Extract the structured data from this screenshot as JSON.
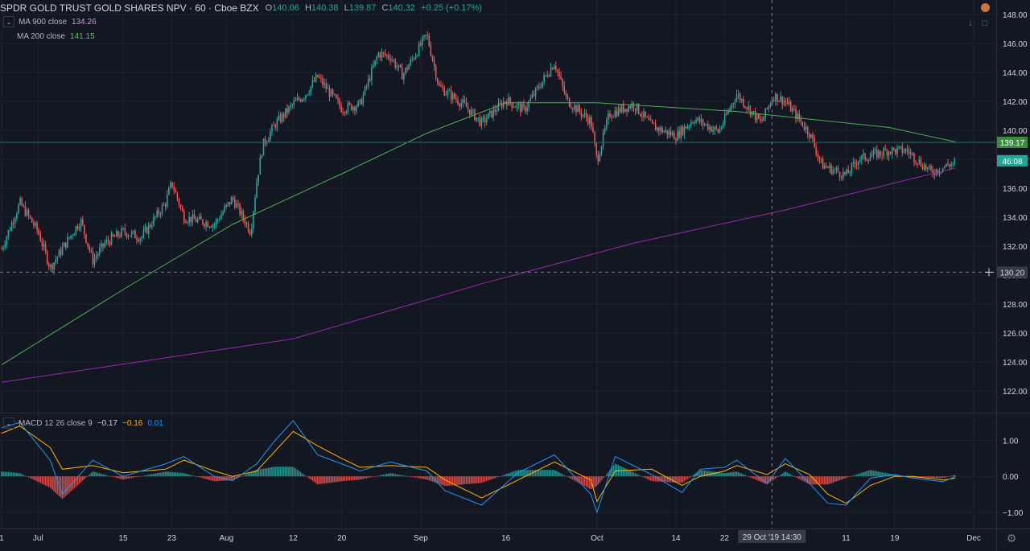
{
  "header": {
    "symbol": "SPDR GOLD TRUST GOLD SHARES NPV · 60 · Cboe BZX",
    "o_label": "O",
    "o_value": "140.06",
    "h_label": "H",
    "h_value": "140.38",
    "l_label": "L",
    "l_value": "139.87",
    "c_label": "C",
    "c_value": "140.32",
    "change": "+0.25 (+0.17%)"
  },
  "indicators": {
    "ma900_label": "MA 900 close",
    "ma900_value": "134.26",
    "ma200_label": "MA 200 close",
    "ma200_value": "141.15",
    "macd_label": "MACD 12 26 close 9",
    "macd_value": "−0.17",
    "signal_value": "−0.16",
    "hist_value": "0.01"
  },
  "colors": {
    "background": "#131722",
    "grid": "#1e222d",
    "up": "#26a69a",
    "down": "#ef5350",
    "ma900": "#9c27b0",
    "ma200": "#4caf50",
    "macd_line": "#2196f3",
    "signal_line": "#ffb300",
    "text": "#b2b5be",
    "axis_text": "#d1d4dc",
    "last_price_bg": "#26a69a",
    "ma200_tag_bg": "#388e3c"
  },
  "icons": {
    "collapse": "chevron-down-icon",
    "top_dot": "status-dot-icon",
    "scroll_down": "arrow-down-icon",
    "fullscreen": "fullscreen-icon",
    "settings": "gear-icon"
  },
  "price_tags": {
    "ma200": "139.17",
    "last": "46:08",
    "crosshair": "130.20"
  },
  "crosshair_time": "29 Oct '19   14:30",
  "chart_data": [
    {
      "type": "candlestick",
      "title": "SPDR GOLD TRUST GOLD SHARES NPV · 60 · Cboe BZX",
      "ylim": [
        120.5,
        149.0
      ],
      "y_ticks": [
        "148.00",
        "146.00",
        "144.00",
        "142.00",
        "140.00",
        "138.00",
        "136.00",
        "134.00",
        "132.00",
        "130.00",
        "128.00",
        "126.00",
        "124.00",
        "122.00"
      ],
      "x_ticks": [
        "1",
        "Jul",
        "15",
        "23",
        "Aug",
        "12",
        "20",
        "Sep",
        "16",
        "Oct",
        "14",
        "22",
        "11",
        "19",
        "Dec"
      ],
      "grid": true,
      "close_path": [
        [
          "Jun 25",
          131.8
        ],
        [
          "Jun 28",
          135.0
        ],
        [
          "Jul 1",
          133.0
        ],
        [
          "Jul 3",
          130.5
        ],
        [
          "Jul 8",
          133.8
        ],
        [
          "Jul 10",
          131.0
        ],
        [
          "Jul 12",
          132.2
        ],
        [
          "Jul 15",
          133.0
        ],
        [
          "Jul 18",
          132.6
        ],
        [
          "Jul 22",
          135.0
        ],
        [
          "Jul 23",
          136.4
        ],
        [
          "Jul 25",
          134.0
        ],
        [
          "Jul 30",
          133.5
        ],
        [
          "Aug 2",
          135.3
        ],
        [
          "Aug 5",
          133.0
        ],
        [
          "Aug 6",
          136.5
        ],
        [
          "Aug 7",
          139.0
        ],
        [
          "Aug 9",
          140.4
        ],
        [
          "Aug 12",
          141.8
        ],
        [
          "Aug 14",
          142.5
        ],
        [
          "Aug 16",
          143.7
        ],
        [
          "Aug 20",
          141.5
        ],
        [
          "Aug 23",
          141.8
        ],
        [
          "Aug 26",
          145.3
        ],
        [
          "Aug 28",
          145.1
        ],
        [
          "Aug 30",
          143.8
        ],
        [
          "Sep 3",
          146.6
        ],
        [
          "Sep 5",
          143.0
        ],
        [
          "Sep 9",
          141.8
        ],
        [
          "Sep 12",
          140.5
        ],
        [
          "Sep 16",
          142.1
        ],
        [
          "Sep 19",
          141.4
        ],
        [
          "Sep 24",
          144.7
        ],
        [
          "Sep 26",
          142.1
        ],
        [
          "Sep 30",
          140.6
        ],
        [
          "Oct 1",
          137.9
        ],
        [
          "Oct 3",
          141.1
        ],
        [
          "Oct 7",
          141.8
        ],
        [
          "Oct 10",
          140.3
        ],
        [
          "Oct 14",
          139.6
        ],
        [
          "Oct 17",
          140.8
        ],
        [
          "Oct 21",
          139.9
        ],
        [
          "Oct 24",
          142.5
        ],
        [
          "Oct 28",
          140.5
        ],
        [
          "Oct 30",
          142.4
        ],
        [
          "Nov 1",
          142.0
        ],
        [
          "Nov 5",
          139.8
        ],
        [
          "Nov 7",
          137.6
        ],
        [
          "Nov 11",
          136.9
        ],
        [
          "Nov 13",
          138.0
        ],
        [
          "Nov 18",
          138.6
        ],
        [
          "Nov 21",
          138.6
        ],
        [
          "Nov 25",
          137.1
        ],
        [
          "Nov 29",
          137.8
        ]
      ],
      "ma900": {
        "label": "MA 900 close",
        "last": 134.26,
        "points": [
          [
            "Jun 25",
            122.6
          ],
          [
            "Aug 12",
            125.6
          ],
          [
            "Sep 12",
            129.4
          ],
          [
            "Oct 7",
            132.2
          ],
          [
            "Nov 1",
            134.5
          ],
          [
            "Nov 29",
            137.4
          ]
        ]
      },
      "ma200": {
        "label": "MA 200 close",
        "last": 141.15,
        "points": [
          [
            "Jun 25",
            123.8
          ],
          [
            "Jul 15",
            129.0
          ],
          [
            "Aug 2",
            133.5
          ],
          [
            "Aug 20",
            137.0
          ],
          [
            "Sep 3",
            139.8
          ],
          [
            "Sep 16",
            141.9
          ],
          [
            "Oct 1",
            141.9
          ],
          [
            "Oct 24",
            141.3
          ],
          [
            "Nov 18",
            140.2
          ],
          [
            "Nov 29",
            139.2
          ]
        ]
      },
      "horizontal_lines": [
        139.17,
        130.2
      ]
    },
    {
      "type": "macd",
      "title": "MACD 12 26 close 9",
      "ylim": [
        -1.45,
        1.75
      ],
      "y_ticks": [
        "1.00",
        "0.00",
        "−1.00"
      ],
      "macd_path": [
        [
          "Jun 25",
          1.35
        ],
        [
          "Jun 28",
          1.5
        ],
        [
          "Jul 3",
          0.45
        ],
        [
          "Jul 5",
          -0.5
        ],
        [
          "Jul 10",
          0.45
        ],
        [
          "Jul 15",
          0.0
        ],
        [
          "Jul 22",
          0.35
        ],
        [
          "Jul 25",
          0.55
        ],
        [
          "Jul 30",
          0.0
        ],
        [
          "Aug 2",
          -0.12
        ],
        [
          "Aug 6",
          0.35
        ],
        [
          "Aug 9",
          1.0
        ],
        [
          "Aug 12",
          1.55
        ],
        [
          "Aug 16",
          0.6
        ],
        [
          "Aug 20",
          0.35
        ],
        [
          "Aug 23",
          0.15
        ],
        [
          "Aug 28",
          0.4
        ],
        [
          "Sep 3",
          0.15
        ],
        [
          "Sep 6",
          -0.4
        ],
        [
          "Sep 12",
          -0.8
        ],
        [
          "Sep 18",
          0.1
        ],
        [
          "Sep 24",
          0.6
        ],
        [
          "Sep 30",
          -0.5
        ],
        [
          "Oct 1",
          -1.0
        ],
        [
          "Oct 4",
          0.55
        ],
        [
          "Oct 10",
          0.05
        ],
        [
          "Oct 15",
          -0.45
        ],
        [
          "Oct 18",
          0.2
        ],
        [
          "Oct 22",
          0.25
        ],
        [
          "Oct 24",
          0.45
        ],
        [
          "Oct 29",
          -0.2
        ],
        [
          "Nov 1",
          0.5
        ],
        [
          "Nov 5",
          -0.2
        ],
        [
          "Nov 8",
          -0.75
        ],
        [
          "Nov 11",
          -0.8
        ],
        [
          "Nov 15",
          -0.05
        ],
        [
          "Nov 19",
          0.05
        ],
        [
          "Nov 22",
          -0.05
        ],
        [
          "Nov 27",
          -0.15
        ],
        [
          "Nov 29",
          0.0
        ]
      ],
      "signal_path": [
        [
          "Jun 25",
          1.2
        ],
        [
          "Jun 28",
          1.4
        ],
        [
          "Jul 3",
          0.8
        ],
        [
          "Jul 5",
          0.2
        ],
        [
          "Jul 10",
          0.3
        ],
        [
          "Jul 15",
          0.1
        ],
        [
          "Jul 22",
          0.2
        ],
        [
          "Jul 25",
          0.45
        ],
        [
          "Jul 30",
          0.15
        ],
        [
          "Aug 2",
          0.0
        ],
        [
          "Aug 6",
          0.15
        ],
        [
          "Aug 9",
          0.7
        ],
        [
          "Aug 12",
          1.25
        ],
        [
          "Aug 16",
          0.85
        ],
        [
          "Aug 20",
          0.5
        ],
        [
          "Aug 23",
          0.25
        ],
        [
          "Aug 28",
          0.3
        ],
        [
          "Sep 3",
          0.25
        ],
        [
          "Sep 6",
          -0.1
        ],
        [
          "Sep 12",
          -0.6
        ],
        [
          "Sep 18",
          -0.1
        ],
        [
          "Sep 24",
          0.4
        ],
        [
          "Sep 30",
          -0.1
        ],
        [
          "Oct 1",
          -0.7
        ],
        [
          "Oct 4",
          0.15
        ],
        [
          "Oct 10",
          0.2
        ],
        [
          "Oct 15",
          -0.25
        ],
        [
          "Oct 18",
          0.0
        ],
        [
          "Oct 22",
          0.15
        ],
        [
          "Oct 24",
          0.3
        ],
        [
          "Oct 29",
          0.05
        ],
        [
          "Nov 1",
          0.35
        ],
        [
          "Nov 5",
          0.05
        ],
        [
          "Nov 8",
          -0.5
        ],
        [
          "Nov 11",
          -0.75
        ],
        [
          "Nov 15",
          -0.25
        ],
        [
          "Nov 19",
          0.0
        ],
        [
          "Nov 22",
          0.0
        ],
        [
          "Nov 27",
          -0.1
        ],
        [
          "Nov 29",
          -0.05
        ]
      ],
      "last": {
        "macd": -0.17,
        "signal": -0.16,
        "histogram": 0.01
      }
    }
  ]
}
